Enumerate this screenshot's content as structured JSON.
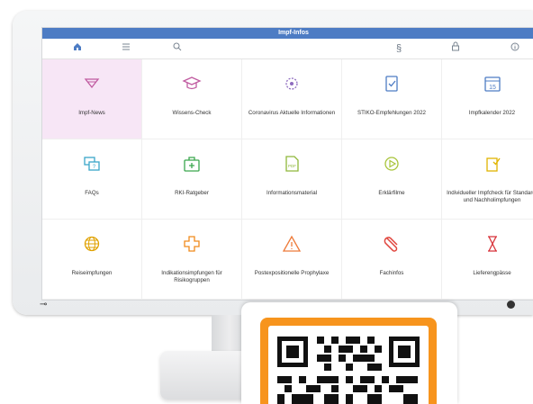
{
  "window": {
    "title": "Impf-Infos"
  },
  "toolbar": {
    "items": [
      "home-icon",
      "menu-icon",
      "search-icon",
      "paragraph-icon",
      "lock-icon",
      "info-icon"
    ]
  },
  "tiles": [
    {
      "label": "Impf-News",
      "icon": "megaphone-icon",
      "active": true
    },
    {
      "label": "Wissens-Check",
      "icon": "graduation-cap-icon"
    },
    {
      "label": "Coronavirus Aktuelle Informationen",
      "icon": "virus-icon"
    },
    {
      "label": "STIKO-Empfehlungen 2022",
      "icon": "clipboard-check-icon"
    },
    {
      "label": "Impfkalender 2022",
      "icon": "calendar-icon",
      "calendar_day": "15"
    },
    {
      "label": "FAQs",
      "icon": "faq-chat-icon"
    },
    {
      "label": "RKI-Ratgeber",
      "icon": "medical-kit-icon"
    },
    {
      "label": "Informationsmaterial",
      "icon": "pdf-document-icon"
    },
    {
      "label": "Erklärfilme",
      "icon": "play-icon"
    },
    {
      "label": "Individueller Impfcheck für Standard- und Nachholimpfungen",
      "icon": "checklist-icon"
    },
    {
      "label": "Reiseimpfungen",
      "icon": "globe-icon"
    },
    {
      "label": "Indikationsimpfungen für Risikogruppen",
      "icon": "cross-icon"
    },
    {
      "label": "Postexpositionelle Prophylaxe",
      "icon": "warning-icon"
    },
    {
      "label": "Fachinfos",
      "icon": "paperclip-icon"
    },
    {
      "label": "Lieferengpässe",
      "icon": "hourglass-icon"
    }
  ],
  "colors": {
    "titlebar": "#4d7cc4",
    "active_tile": "#f7e6f6",
    "qr_frame": "#f7941d"
  }
}
